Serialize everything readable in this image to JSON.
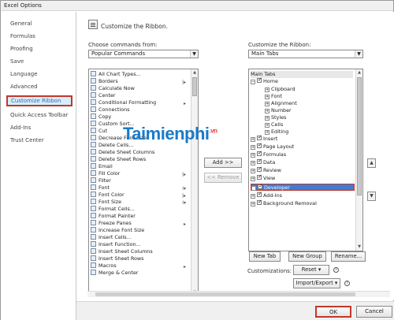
{
  "window": {
    "title": "Excel Options"
  },
  "nav": {
    "items": [
      {
        "label": "General",
        "selected": false
      },
      {
        "label": "Formulas",
        "selected": false
      },
      {
        "label": "Proofing",
        "selected": false
      },
      {
        "label": "Save",
        "selected": false
      },
      {
        "label": "Language",
        "selected": false
      },
      {
        "label": "Advanced",
        "selected": false
      },
      {
        "label": "Customize Ribbon",
        "selected": true
      },
      {
        "label": "Quick Access Toolbar",
        "selected": false
      },
      {
        "label": "Add-Ins",
        "selected": false
      },
      {
        "label": "Trust Center",
        "selected": false
      }
    ]
  },
  "header": {
    "text": "Customize the Ribbon."
  },
  "commands": {
    "label": "Choose commands from:",
    "value": "Popular Commands",
    "items": [
      "All Chart Types...",
      "Borders",
      "Calculate Now",
      "Center",
      "Conditional Formatting",
      "Connections",
      "Copy",
      "Custom Sort...",
      "Cut",
      "Decrease Font Size",
      "Delete Cells...",
      "Delete Sheet Columns",
      "Delete Sheet Rows",
      "Email",
      "Fill Color",
      "Filter",
      "Font",
      "Font Color",
      "Font Size",
      "Format Cells...",
      "Format Painter",
      "Freeze Panes",
      "Increase Font Size",
      "Insert Cells...",
      "Insert Function...",
      "Insert Sheet Columns",
      "Insert Sheet Rows",
      "Macros",
      "Merge & Center"
    ]
  },
  "ribbon": {
    "label": "Customize the Ribbon:",
    "value": "Main Tabs",
    "group_label": "Main Tabs",
    "home": "Home",
    "home_children": [
      "Clipboard",
      "Font",
      "Alignment",
      "Number",
      "Styles",
      "Cells",
      "Editing"
    ],
    "tabs": [
      "Insert",
      "Page Layout",
      "Formulas",
      "Data",
      "Review",
      "View",
      "Developer",
      "Add-Ins",
      "Background Removal"
    ]
  },
  "buttons": {
    "add": "Add >>",
    "remove": "<< Remove",
    "new_tab": "New Tab",
    "new_group": "New Group",
    "rename": "Rename...",
    "customizations": "Customizations:",
    "reset": "Reset",
    "import_export": "Import/Export",
    "ok": "OK",
    "cancel": "Cancel"
  },
  "watermark": {
    "main": "Taimienphi",
    "sub": ".vn"
  }
}
